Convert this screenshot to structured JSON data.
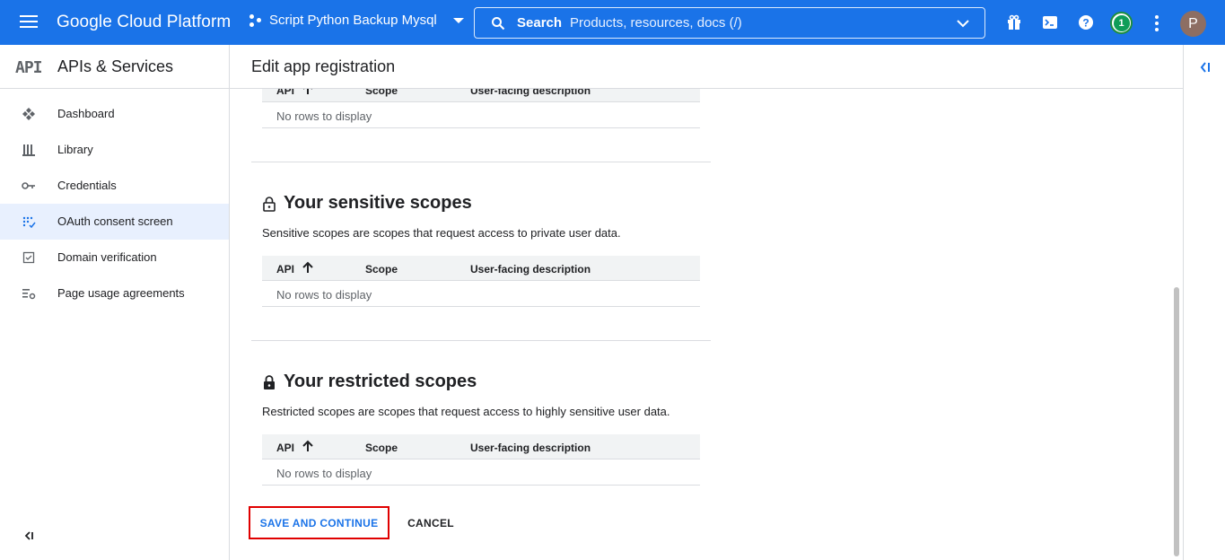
{
  "topbar": {
    "brand": "Google Cloud Platform",
    "project_name": "Script Python Backup Mysql",
    "search_label": "Search",
    "search_placeholder": "Products, resources, docs (/)",
    "notification_count": "1",
    "avatar_initial": "P",
    "bg_color": "#1a73e8"
  },
  "sidebar": {
    "logo_text": "API",
    "title": "APIs & Services",
    "items": [
      {
        "label": "Dashboard",
        "icon": "dashboard-icon",
        "active": false
      },
      {
        "label": "Library",
        "icon": "library-icon",
        "active": false
      },
      {
        "label": "Credentials",
        "icon": "key-icon",
        "active": false
      },
      {
        "label": "OAuth consent screen",
        "icon": "consent-icon",
        "active": true
      },
      {
        "label": "Domain verification",
        "icon": "checkbox-icon",
        "active": false
      },
      {
        "label": "Page usage agreements",
        "icon": "settings-list-icon",
        "active": false
      }
    ]
  },
  "main": {
    "page_title": "Edit app registration",
    "table_headers": {
      "api": "API",
      "scope": "Scope",
      "description": "User-facing description"
    },
    "empty_text": "No rows to display",
    "sensitive": {
      "title": "Your sensitive scopes",
      "description": "Sensitive scopes are scopes that request access to private user data."
    },
    "restricted": {
      "title": "Your restricted scopes",
      "description": "Restricted scopes are scopes that request access to highly sensitive user data."
    },
    "save_label": "SAVE AND CONTINUE",
    "cancel_label": "CANCEL"
  }
}
